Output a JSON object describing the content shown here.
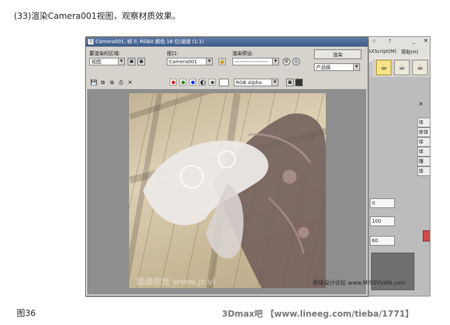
{
  "caption_top": "(33)渲染Camera001视图，观察材质效果。",
  "caption_bottom": "图36",
  "credit": "3Dmax吧 【www.lineeg.com/tieba/1771】",
  "watermark_image": "思缘设计论坛 www.MISSYUAN.com",
  "watermark_faded": "思缘视觉 www.jr.vl",
  "background_app": {
    "menu_items": [
      "?",
      "☆",
      "AXScript(M)",
      "帮助(H)"
    ],
    "panel_items": [
      "体",
      "修体",
      "体",
      "体",
      "雕",
      "体"
    ],
    "spinner_values": [
      "0",
      "100",
      "60"
    ]
  },
  "render_window": {
    "title": "Camera001, 帧 0, RGBA 颜色 16 位/通道 (1:1)",
    "area_label": "要渲染的区域:",
    "area_value": "视图",
    "viewport_label": "视口:",
    "viewport_value": "Camera001",
    "preset_label": "渲染预设:",
    "preset_value": "-------------------",
    "render_button": "渲染",
    "quality_value": "产品级",
    "channel_value": "RGB Alpha",
    "colors": {
      "red": "#d81a1a",
      "green": "#1a8a1a",
      "blue": "#1a2ad8",
      "accent_title": "#3d5b88"
    }
  }
}
